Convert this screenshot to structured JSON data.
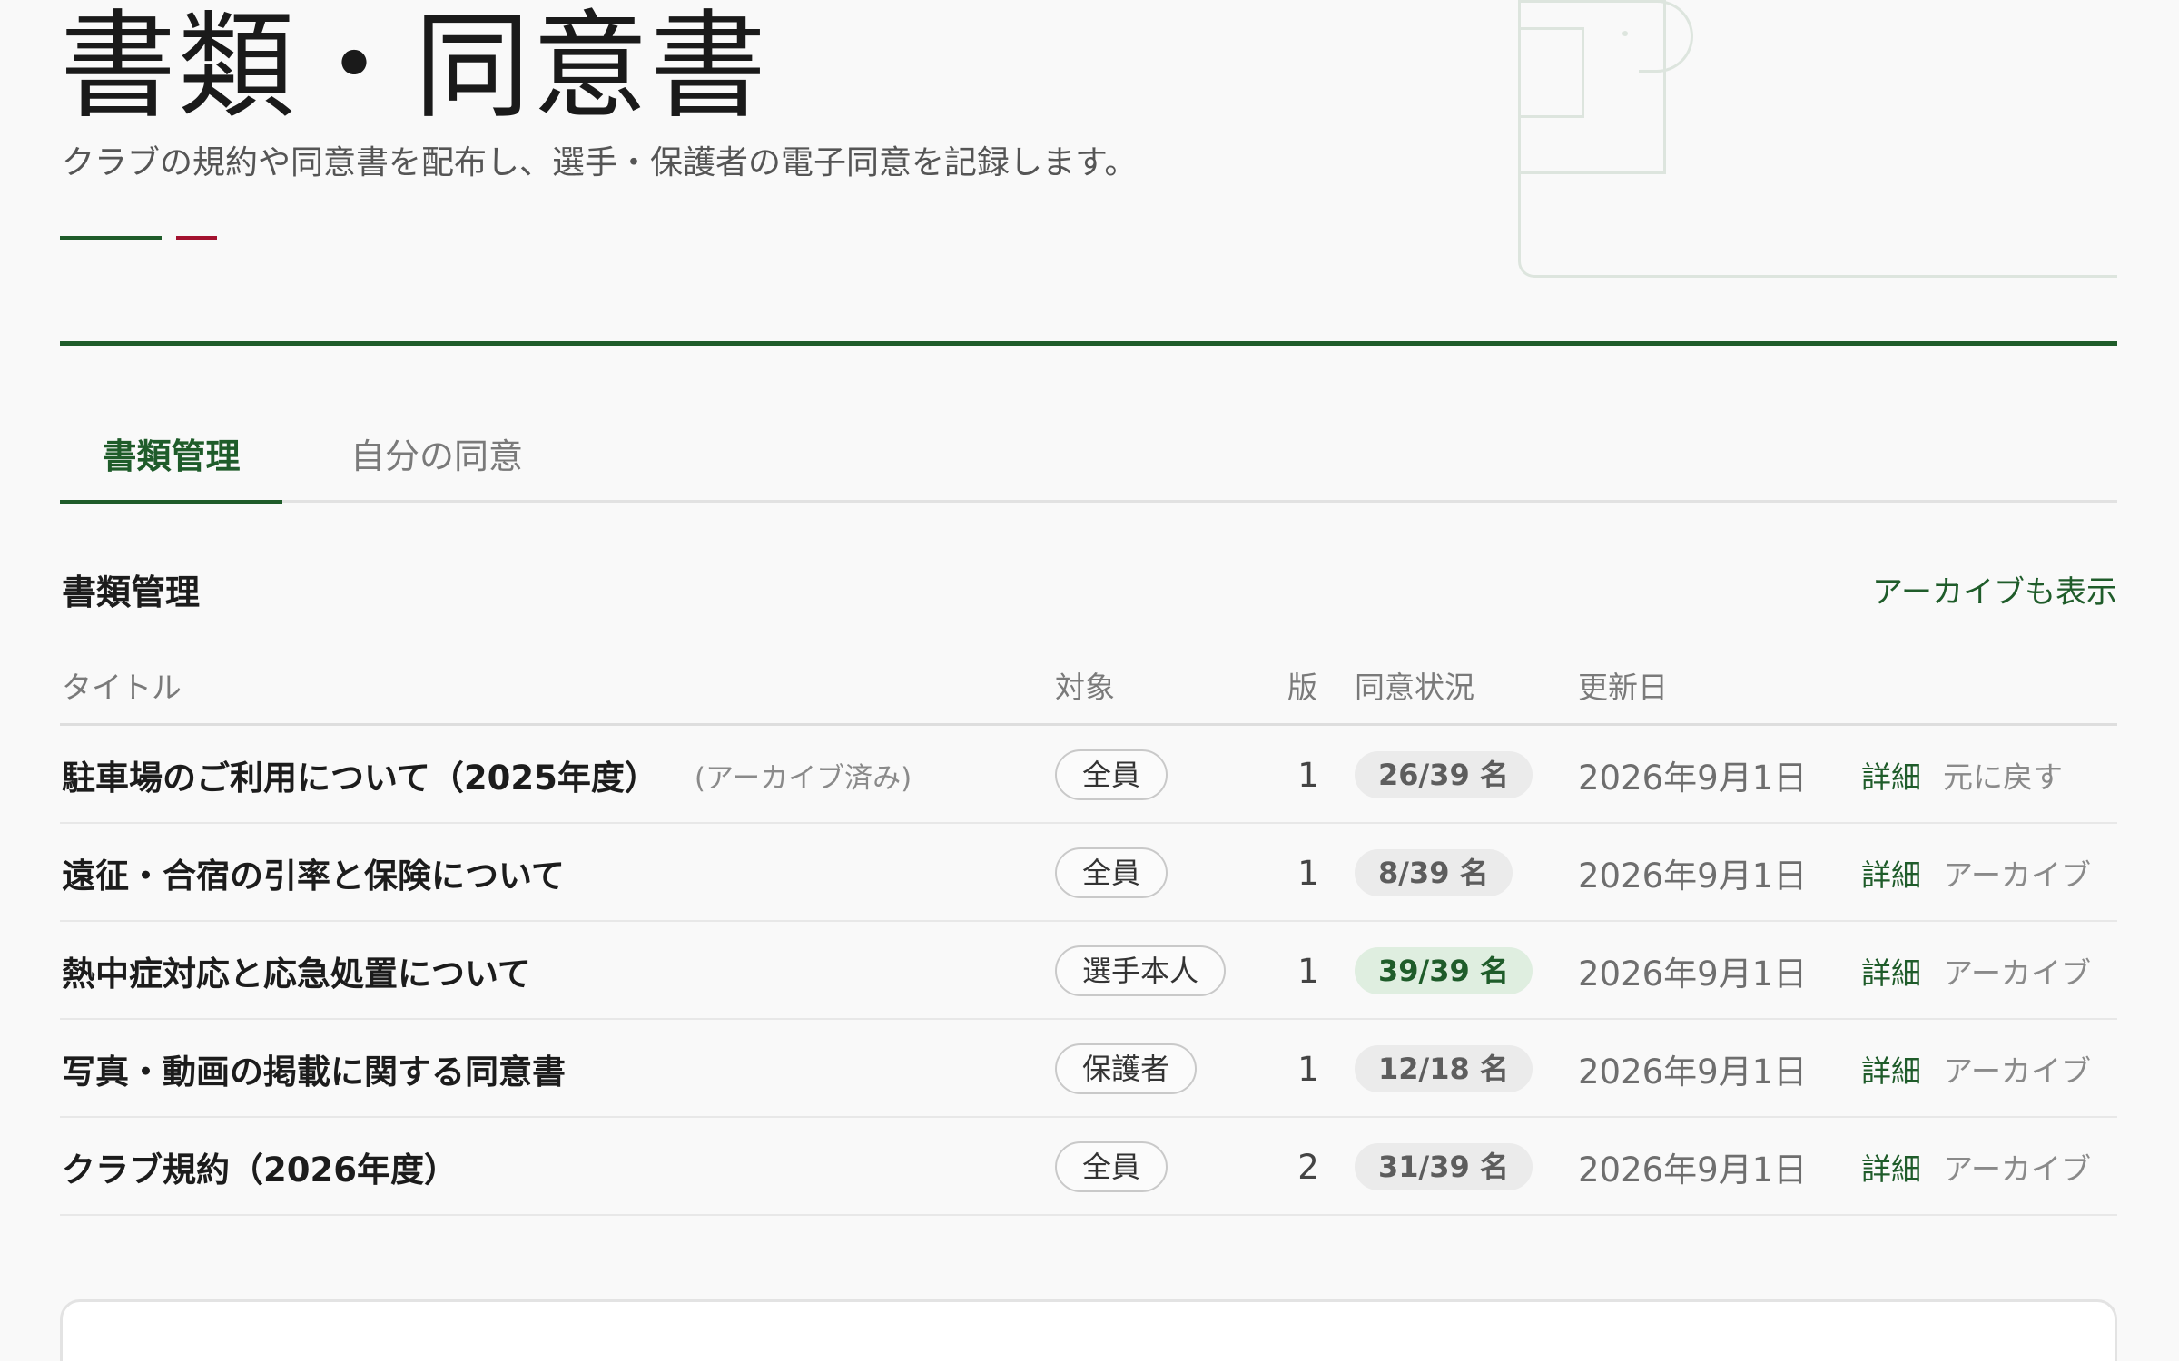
{
  "header": {
    "title": "書類・同意書",
    "subtitle": "クラブの規約や同意書を配布し、選手・保護者の電子同意を記録します。",
    "colors": {
      "accent_green": "#1f5c2a",
      "accent_red": "#a3122f"
    }
  },
  "tabs": [
    {
      "label": "書類管理",
      "active": true
    },
    {
      "label": "自分の同意",
      "active": false
    }
  ],
  "section": {
    "title": "書類管理",
    "archive_toggle_label": "アーカイブも表示"
  },
  "table": {
    "columns": [
      "タイトル",
      "対象",
      "版",
      "同意状況",
      "更新日"
    ],
    "rows": [
      {
        "title": "駐車場のご利用について（2025年度）",
        "archived_label": "(アーカイブ済み)",
        "target": "全員",
        "version": "1",
        "status": "26/39 名",
        "status_complete": false,
        "updated": "2026年9月1日",
        "detail": "詳細",
        "action": "元に戻す"
      },
      {
        "title": "遠征・合宿の引率と保険について",
        "archived_label": "",
        "target": "全員",
        "version": "1",
        "status": "8/39 名",
        "status_complete": false,
        "updated": "2026年9月1日",
        "detail": "詳細",
        "action": "アーカイブ"
      },
      {
        "title": "熱中症対応と応急処置について",
        "archived_label": "",
        "target": "選手本人",
        "version": "1",
        "status": "39/39 名",
        "status_complete": true,
        "updated": "2026年9月1日",
        "detail": "詳細",
        "action": "アーカイブ"
      },
      {
        "title": "写真・動画の掲載に関する同意書",
        "archived_label": "",
        "target": "保護者",
        "version": "1",
        "status": "12/18 名",
        "status_complete": false,
        "updated": "2026年9月1日",
        "detail": "詳細",
        "action": "アーカイブ"
      },
      {
        "title": "クラブ規約（2026年度）",
        "archived_label": "",
        "target": "全員",
        "version": "2",
        "status": "31/39 名",
        "status_complete": false,
        "updated": "2026年9月1日",
        "detail": "詳細",
        "action": "アーカイブ"
      }
    ]
  }
}
